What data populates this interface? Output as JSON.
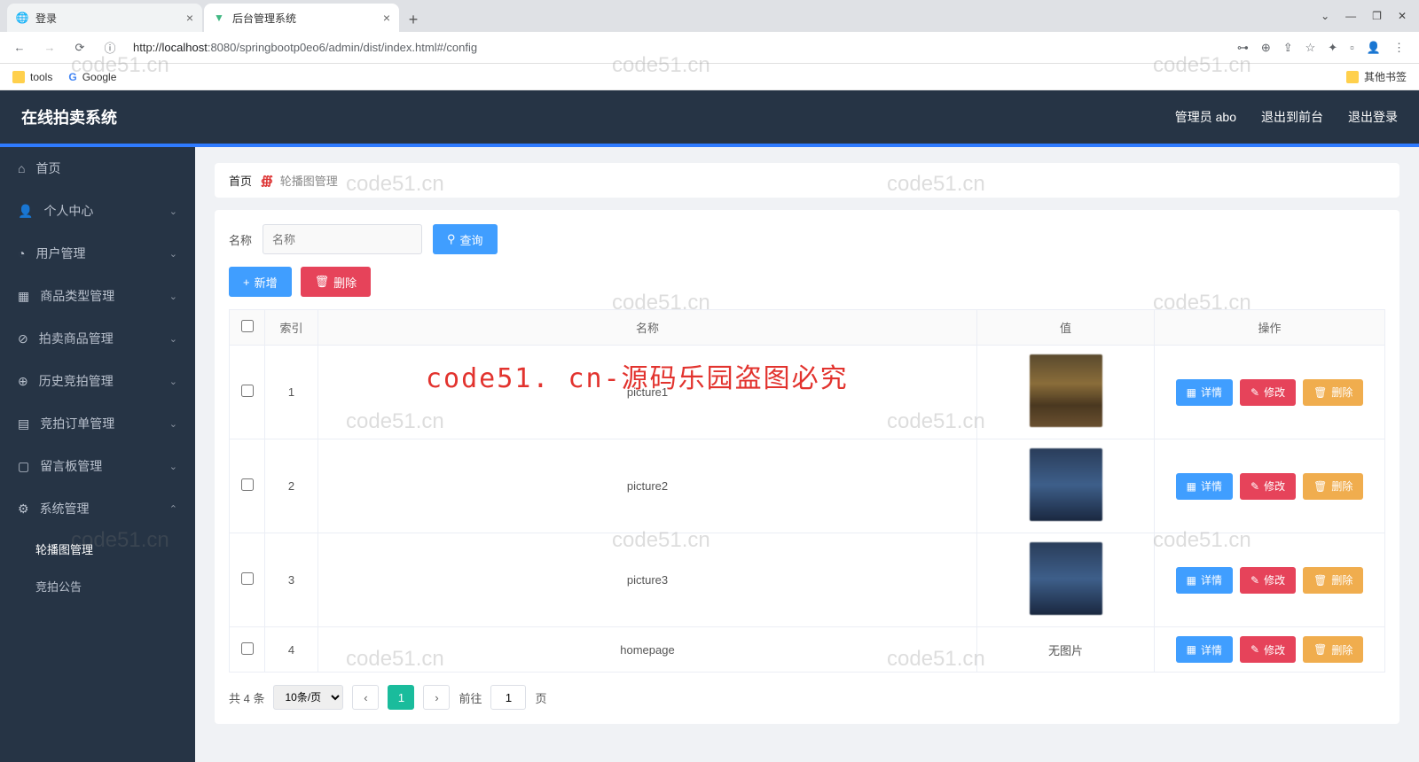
{
  "browser": {
    "tabs": [
      {
        "title": "登录"
      },
      {
        "title": "后台管理系统"
      }
    ],
    "url_host": "localhost",
    "url_port": ":8080",
    "url_path": "/springbootp0eo6/admin/dist/index.html#/config",
    "url_prefix": "http://",
    "bookmarks": {
      "tools": "tools",
      "google": "Google",
      "other": "其他书签"
    }
  },
  "header": {
    "title": "在线拍卖系统",
    "admin": "管理员 abo",
    "to_front": "退出到前台",
    "logout": "退出登录"
  },
  "sidebar": {
    "items": [
      {
        "label": "首页",
        "icon": "home"
      },
      {
        "label": "个人中心",
        "icon": "user",
        "expandable": true
      },
      {
        "label": "用户管理",
        "icon": "clock",
        "expandable": true
      },
      {
        "label": "商品类型管理",
        "icon": "grid",
        "expandable": true
      },
      {
        "label": "拍卖商品管理",
        "icon": "check",
        "expandable": true
      },
      {
        "label": "历史竞拍管理",
        "icon": "globe",
        "expandable": true
      },
      {
        "label": "竞拍订单管理",
        "icon": "list",
        "expandable": true
      },
      {
        "label": "留言板管理",
        "icon": "message",
        "expandable": true
      },
      {
        "label": "系统管理",
        "icon": "settings",
        "expandable": true,
        "expanded": true
      }
    ],
    "subs": [
      {
        "label": "轮播图管理",
        "active": true
      },
      {
        "label": "竞拍公告"
      }
    ]
  },
  "crumb": {
    "home": "首页",
    "current": "轮播图管理"
  },
  "filter": {
    "label": "名称",
    "placeholder": "名称",
    "search": "查询"
  },
  "actions": {
    "add": "新增",
    "del": "删除"
  },
  "table": {
    "cols": {
      "idx": "索引",
      "name": "名称",
      "val": "值",
      "ops": "操作"
    },
    "rows": [
      {
        "idx": "1",
        "name": "picture1",
        "img": "t1"
      },
      {
        "idx": "2",
        "name": "picture2",
        "img": "t2"
      },
      {
        "idx": "3",
        "name": "picture3",
        "img": "t2"
      },
      {
        "idx": "4",
        "name": "homepage",
        "noimg": "无图片"
      }
    ],
    "ops": {
      "detail": "详情",
      "edit": "修改",
      "del": "删除"
    }
  },
  "pager": {
    "total": "共 4 条",
    "size": "10条/页",
    "page": "1",
    "goto_pre": "前往",
    "goto_suf": "页",
    "cur": "1"
  },
  "watermarks": {
    "wm": "code51.cn",
    "red": "code51. cn-源码乐园盗图必究"
  }
}
